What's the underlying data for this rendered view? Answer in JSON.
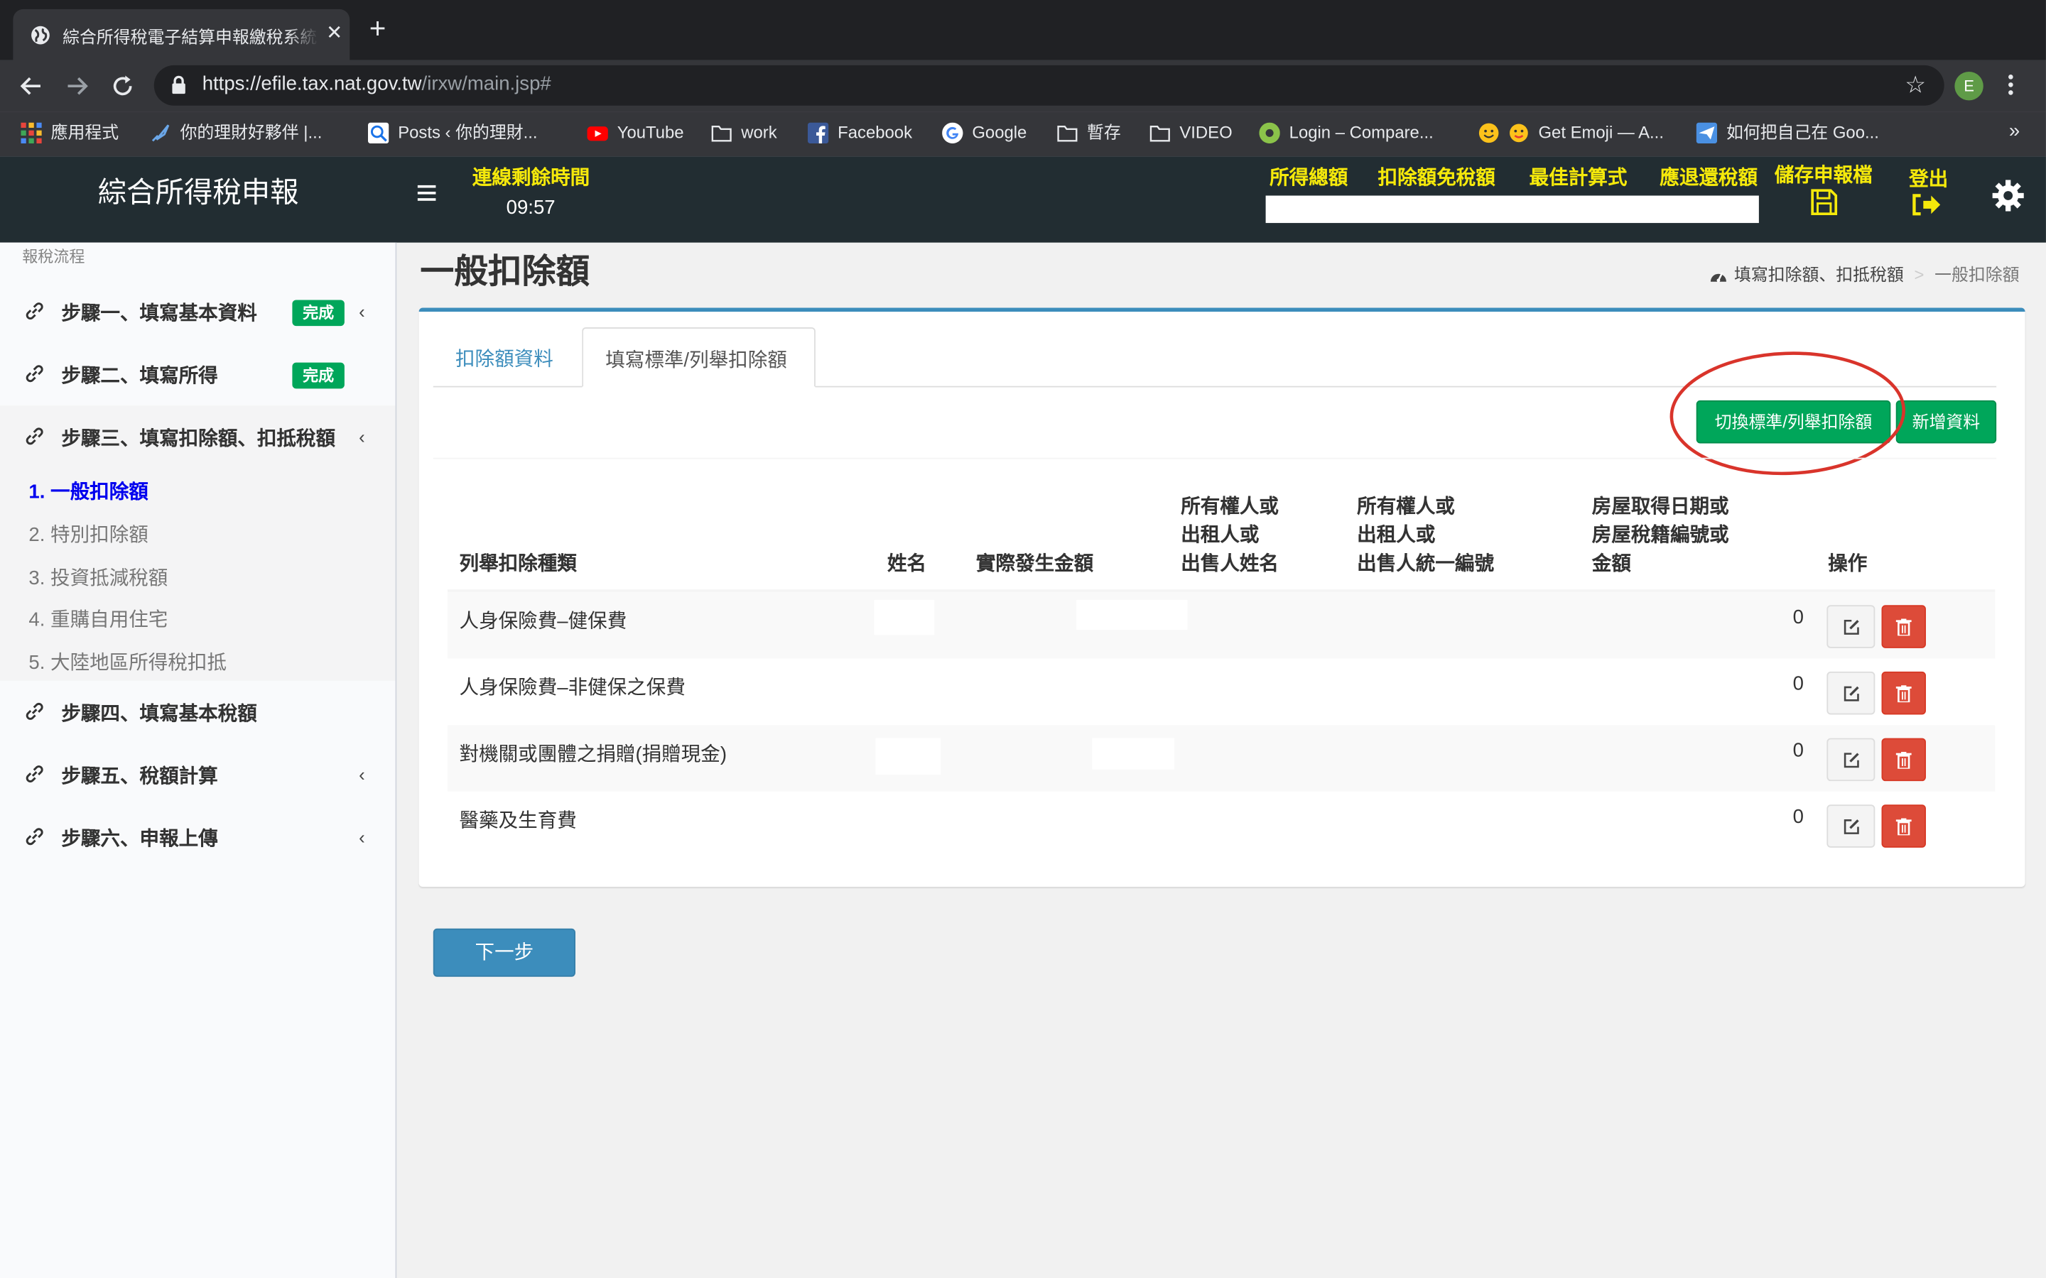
{
  "browser": {
    "tab_title": "綜合所得稅電子結算申報繳稅系統",
    "url_host": "https://efile.tax.nat.gov.tw",
    "url_path": "/irxw/main.jsp#",
    "profile_initial": "E",
    "bookmarks": [
      "應用程式",
      "你的理財好夥伴 |...",
      "Posts ‹ 你的理財...",
      "YouTube",
      "work",
      "Facebook",
      "Google",
      "暫存",
      "VIDEO",
      "Login – Compare...",
      "Get Emoji — A...",
      "如何把自己在 Goo..."
    ],
    "bookmarks_more": "»"
  },
  "header": {
    "brand": "綜合所得稅申報",
    "timer_label": "連線剩餘時間",
    "timer_value": "09:57",
    "links": [
      "所得總額",
      "扣除額免稅額",
      "最佳計算式",
      "應退還稅額",
      "儲存申報檔",
      "登出"
    ]
  },
  "sidebar": {
    "header": "報稅流程",
    "steps": [
      {
        "label": "步驟一、填寫基本資料",
        "badge": "完成"
      },
      {
        "label": "步驟二、填寫所得",
        "badge": "完成"
      },
      {
        "label": "步驟三、填寫扣除額、扣抵稅額"
      },
      {
        "label": "步驟四、填寫基本稅額"
      },
      {
        "label": "步驟五、稅額計算"
      },
      {
        "label": "步驟六、申報上傳"
      }
    ],
    "sub_items": [
      "1. 一般扣除額",
      "2. 特別扣除額",
      "3. 投資抵減稅額",
      "4. 重購自用住宅",
      "5. 大陸地區所得稅扣抵"
    ]
  },
  "content": {
    "page_title": "一般扣除額",
    "breadcrumb": [
      "填寫扣除額、扣抵稅額",
      "一般扣除額"
    ],
    "tabs": [
      "扣除額資料",
      "填寫標準/列舉扣除額"
    ],
    "switch_button": "切換標準/列舉扣除額",
    "add_button": "新增資料",
    "table": {
      "headers": [
        [
          "列舉扣除種類"
        ],
        [
          "姓名"
        ],
        [
          "實際發生金額"
        ],
        [
          "所有權人或",
          "出租人或",
          "出售人姓名"
        ],
        [
          "所有權人或",
          "出租人或",
          "出售人統一編號"
        ],
        [
          "房屋取得日期或",
          "房屋稅籍編號或",
          "金額"
        ],
        [
          "操作"
        ]
      ],
      "rows": [
        {
          "type": "人身保險費–健保費",
          "amount": "0"
        },
        {
          "type": "人身保險費–非健保之保費",
          "amount": "0"
        },
        {
          "type": "對機關或團體之捐贈(捐贈現金)",
          "amount": "0"
        },
        {
          "type": "醫藥及生育費",
          "amount": "0"
        }
      ]
    },
    "next_button": "下一步"
  },
  "colors": {
    "accent_blue": "#3c8dbc",
    "success_green": "#00a65a",
    "danger_red": "#dd4b39",
    "header_yellow": "#f5e90b",
    "annotation_red": "#d9342b"
  }
}
